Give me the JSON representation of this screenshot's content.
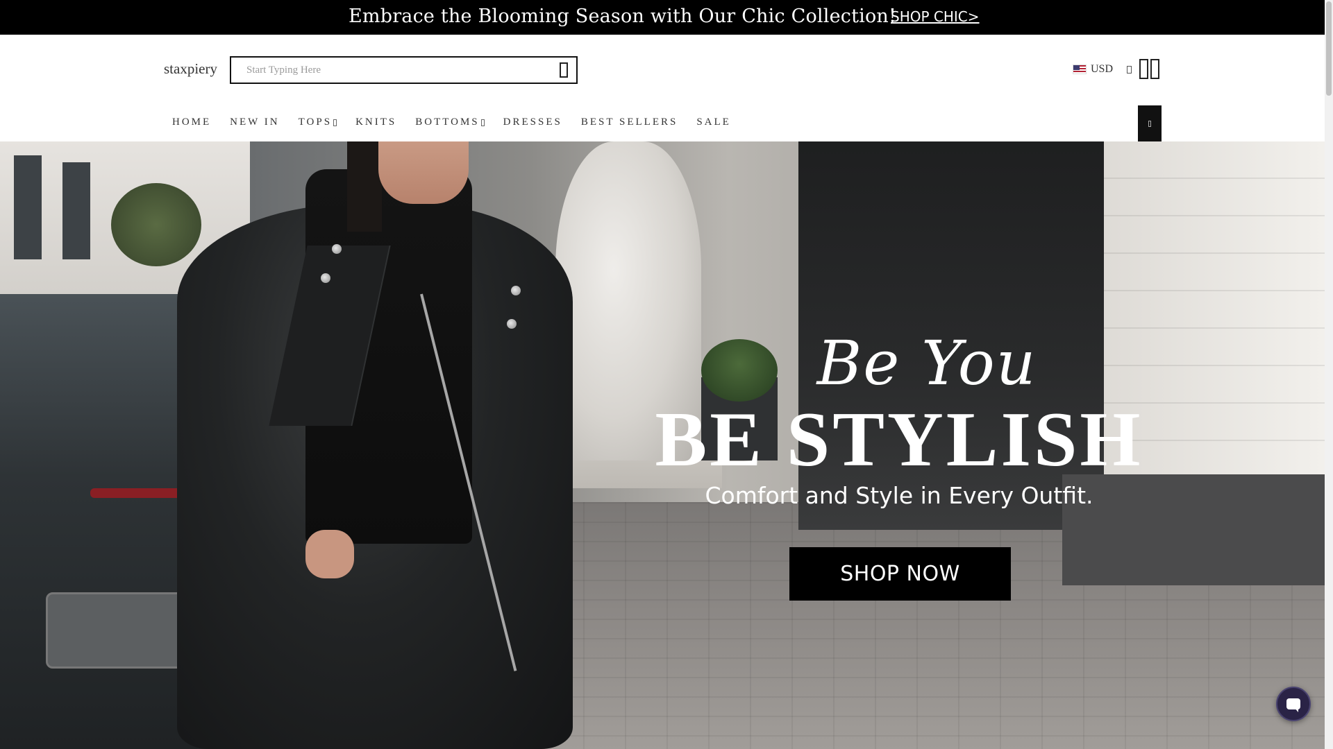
{
  "announcement": {
    "text": "Embrace the Blooming Season with Our Chic Collection!",
    "link_label": "SHOP CHIC>"
  },
  "header": {
    "logo": "staxpiery",
    "search": {
      "placeholder": "Start Typing Here",
      "value": ""
    },
    "currency": "USD",
    "icons": [
      "search-icon",
      "chevron-down-icon",
      "account-icon",
      "cart-icon",
      "menu-icon",
      "chat-icon"
    ]
  },
  "nav": {
    "items": [
      {
        "label": "HOME"
      },
      {
        "label": "NEW IN"
      },
      {
        "label": "TOPS"
      },
      {
        "label": "KNITS"
      },
      {
        "label": "BOTTOMS"
      },
      {
        "label": "DRESSES"
      },
      {
        "label": "BEST SELLERS"
      },
      {
        "label": "SALE"
      }
    ]
  },
  "hero": {
    "script": "Be You",
    "title": "BE STYLISH",
    "subtitle": "Comfort and Style in Every Outfit.",
    "cta": "SHOP NOW"
  },
  "colors": {
    "announcement_bg": "#000000",
    "cta_bg": "#000000",
    "chat_bg": "#2a2346"
  }
}
